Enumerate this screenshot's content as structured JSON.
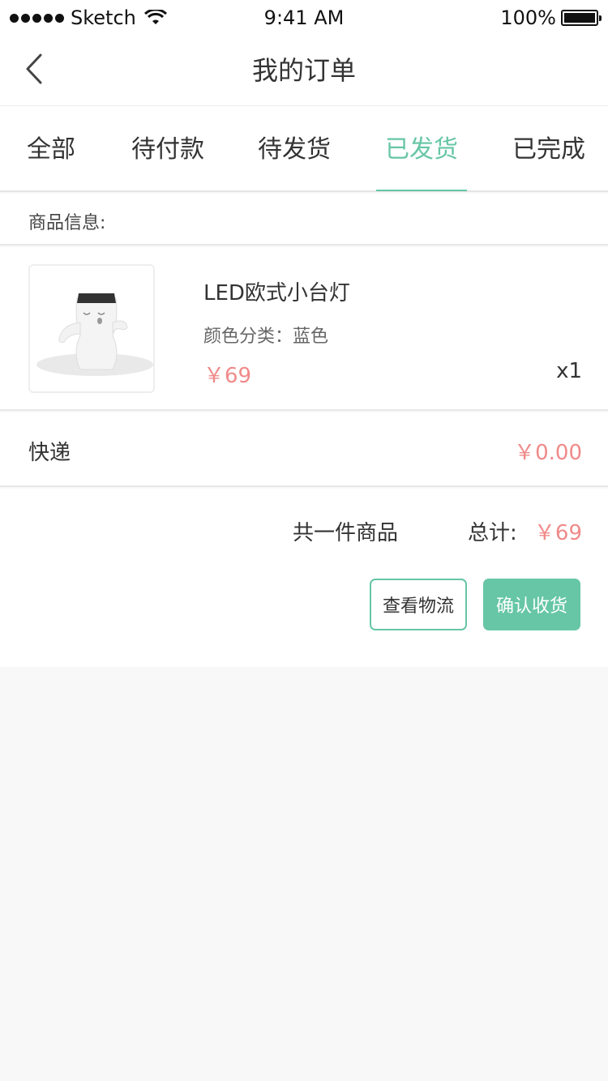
{
  "status_bar": {
    "carrier": "Sketch",
    "time": "9:41 AM",
    "battery": "100%"
  },
  "nav": {
    "title": "我的订单"
  },
  "tabs": [
    {
      "label": "全部"
    },
    {
      "label": "待付款"
    },
    {
      "label": "待发货"
    },
    {
      "label": "已发货",
      "active": true
    },
    {
      "label": "已完成"
    }
  ],
  "order": {
    "section_title": "商品信息:",
    "product": {
      "name": "LED欧式小台灯",
      "spec": "颜色分类：蓝色",
      "price": "￥69",
      "qty": "x1"
    },
    "shipping": {
      "label": "快递",
      "fee": "￥0.00"
    },
    "summary": {
      "count": "共一件商品",
      "total_label": "总计:",
      "total_value": "￥69"
    },
    "actions": {
      "logistics": "查看物流",
      "confirm": "确认收货"
    }
  },
  "colors": {
    "accent": "#66c6a6",
    "price": "#f08a8a"
  }
}
